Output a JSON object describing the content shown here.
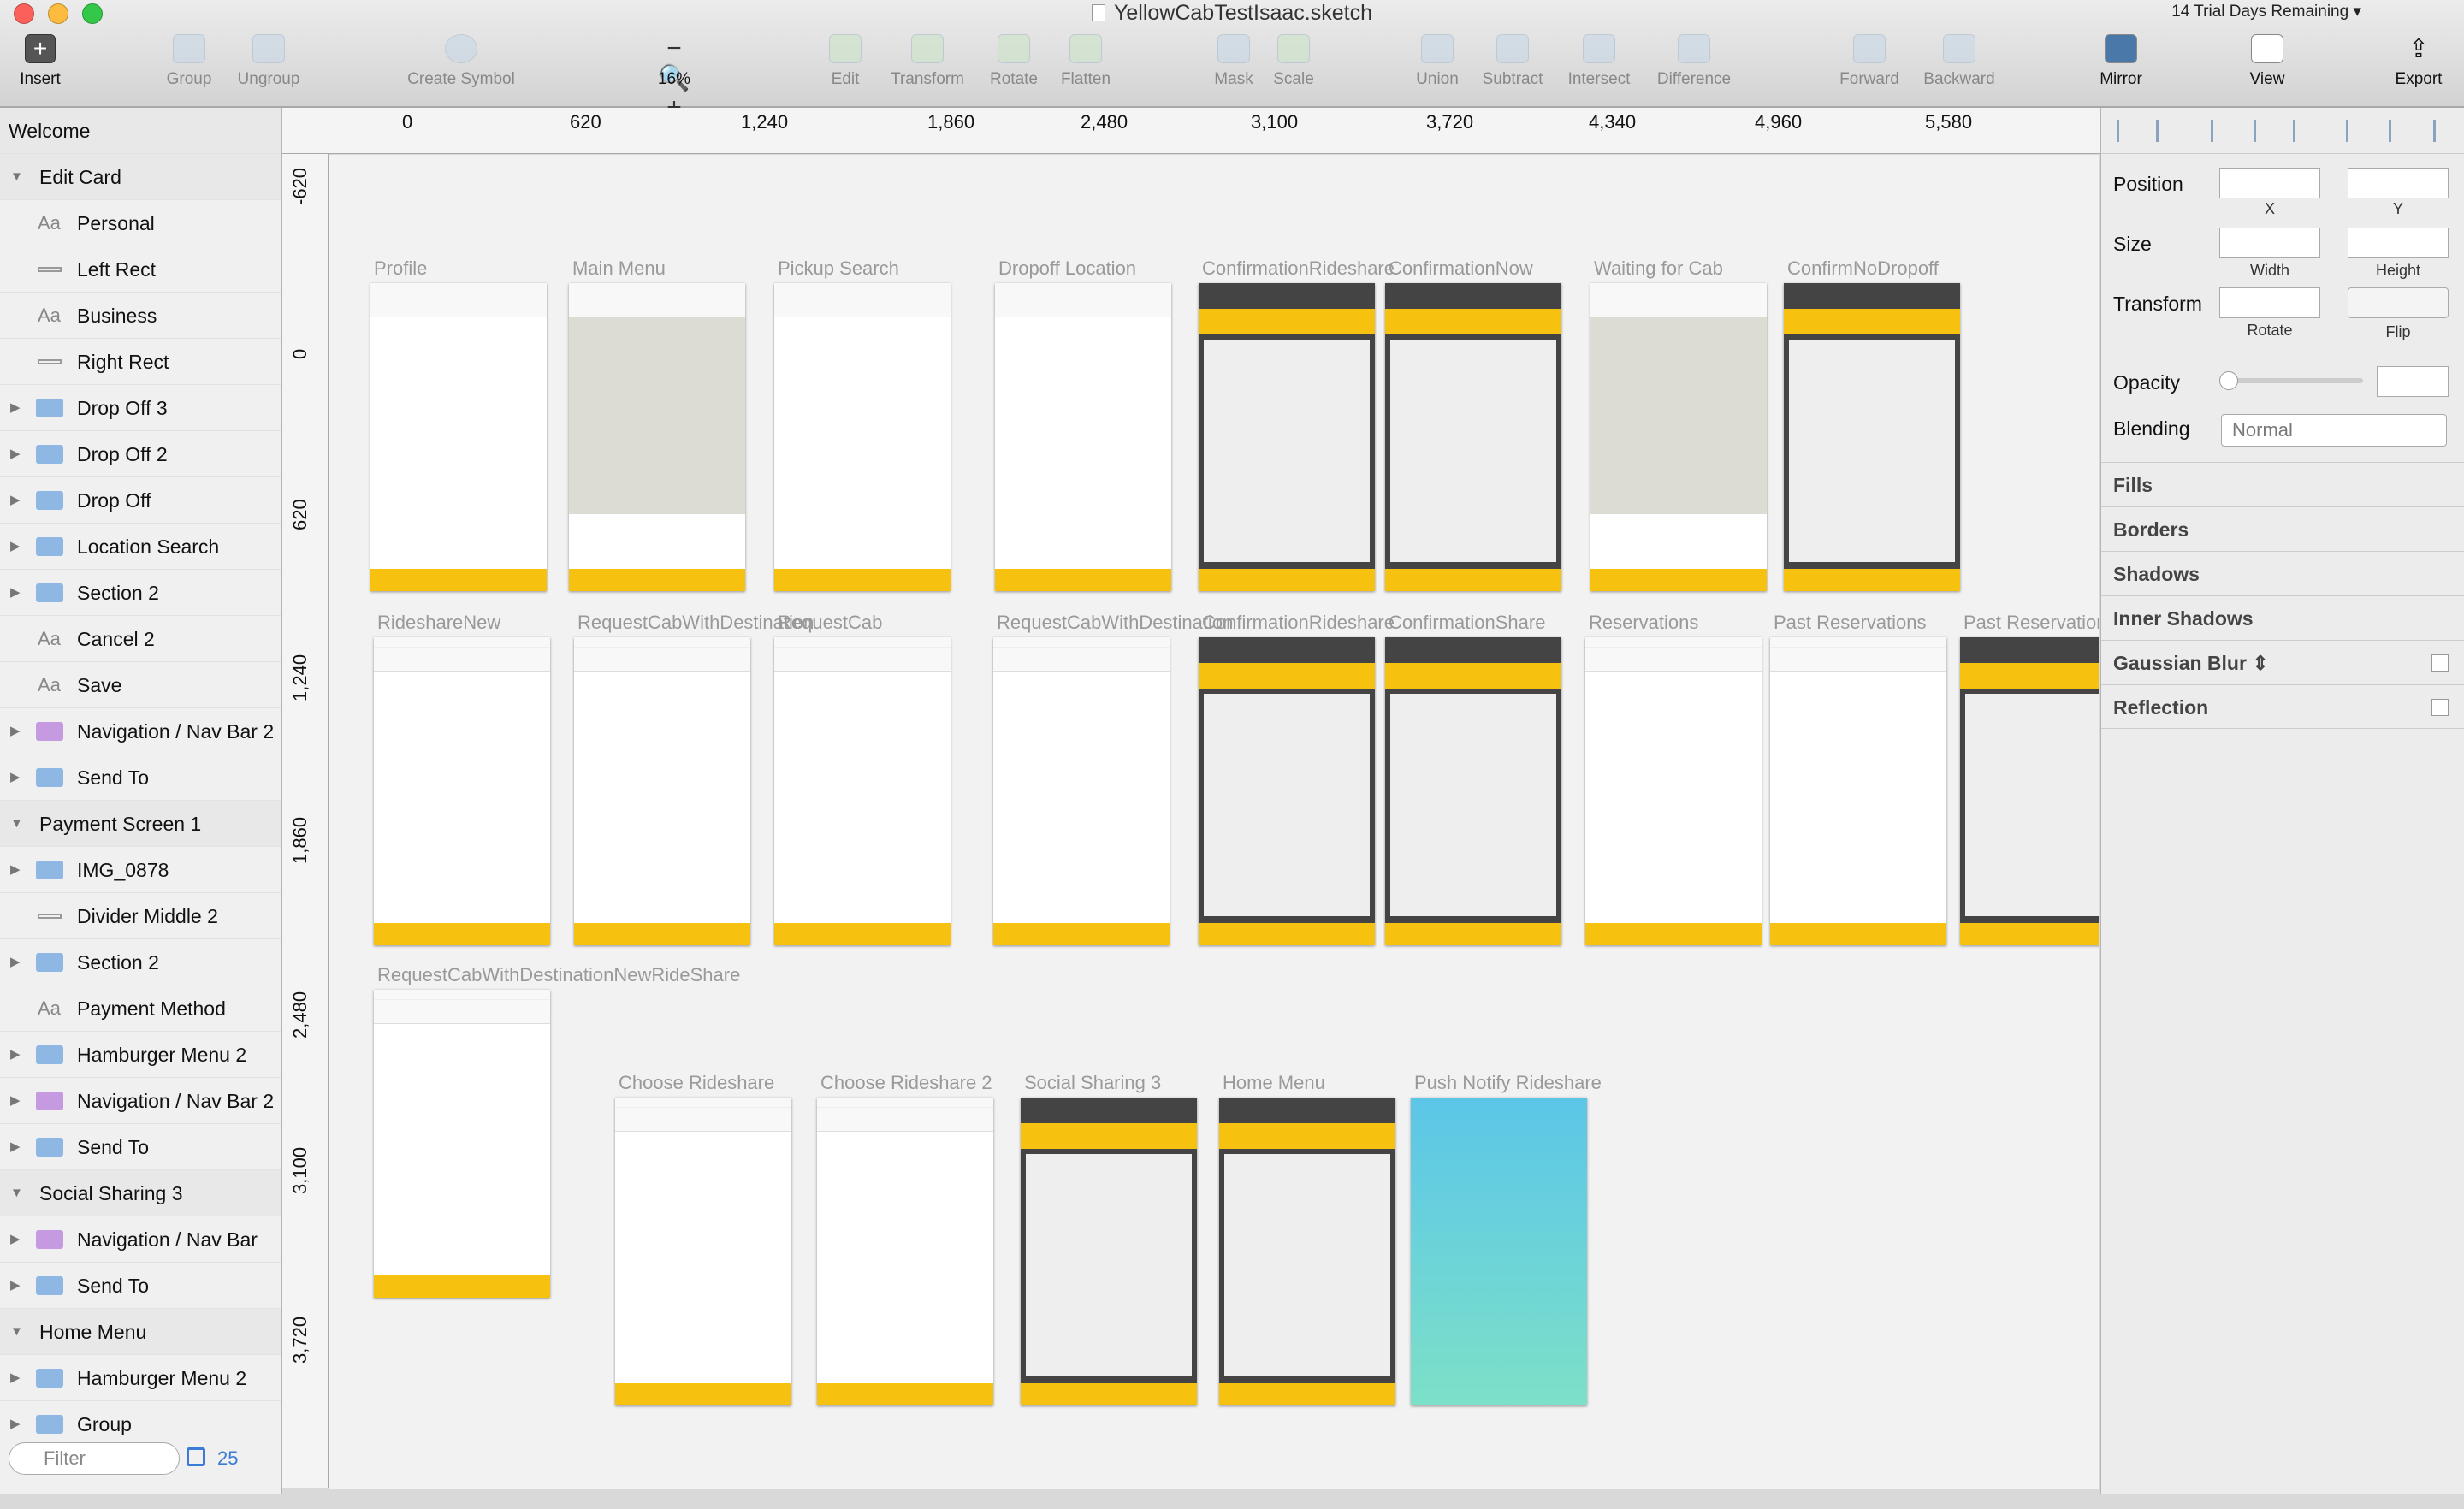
{
  "window": {
    "title": "YellowCabTestIsaac.sketch",
    "trial": "14 Trial Days Remaining ▾"
  },
  "toolbar": {
    "insert": "Insert",
    "group": "Group",
    "ungroup": "Ungroup",
    "create_symbol": "Create Symbol",
    "zoom": "16%",
    "edit": "Edit",
    "transform": "Transform",
    "rotate": "Rotate",
    "flatten": "Flatten",
    "mask": "Mask",
    "scale": "Scale",
    "union": "Union",
    "subtract": "Subtract",
    "intersect": "Intersect",
    "difference": "Difference",
    "forward": "Forward",
    "backward": "Backward",
    "mirror": "Mirror",
    "view": "View",
    "export": "Export"
  },
  "layers": [
    {
      "label": "Welcome",
      "kind": "page"
    },
    {
      "label": "Edit Card",
      "kind": "page"
    },
    {
      "label": "Personal",
      "kind": "text"
    },
    {
      "label": "Left Rect",
      "kind": "rect"
    },
    {
      "label": "Business",
      "kind": "text"
    },
    {
      "label": "Right Rect",
      "kind": "rect"
    },
    {
      "label": "Drop Off 3",
      "kind": "folder"
    },
    {
      "label": "Drop Off 2",
      "kind": "folder"
    },
    {
      "label": "Drop Off",
      "kind": "folder"
    },
    {
      "label": "Location Search",
      "kind": "folder"
    },
    {
      "label": "Section 2",
      "kind": "folder"
    },
    {
      "label": "Cancel 2",
      "kind": "text"
    },
    {
      "label": "Save",
      "kind": "text"
    },
    {
      "label": "Navigation / Nav Bar 2",
      "kind": "symbol"
    },
    {
      "label": "Send To",
      "kind": "folder"
    },
    {
      "label": "Payment Screen 1",
      "kind": "page"
    },
    {
      "label": "IMG_0878",
      "kind": "folder"
    },
    {
      "label": "Divider Middle 2",
      "kind": "rect"
    },
    {
      "label": "Section 2",
      "kind": "folder"
    },
    {
      "label": "Payment Method",
      "kind": "text"
    },
    {
      "label": "Hamburger Menu 2",
      "kind": "folder"
    },
    {
      "label": "Navigation / Nav Bar 2",
      "kind": "symbol"
    },
    {
      "label": "Send To",
      "kind": "folder"
    },
    {
      "label": "Social Sharing 3",
      "kind": "page"
    },
    {
      "label": "Navigation / Nav Bar",
      "kind": "symbol"
    },
    {
      "label": "Send To",
      "kind": "folder"
    },
    {
      "label": "Home Menu",
      "kind": "page"
    },
    {
      "label": "Hamburger Menu 2",
      "kind": "folder"
    },
    {
      "label": "Group",
      "kind": "folder"
    }
  ],
  "filter": {
    "placeholder": "Filter",
    "count": "25"
  },
  "ruler_h": [
    "0",
    "620",
    "1,240",
    "1,860",
    "2,480",
    "3,100",
    "3,720",
    "4,340",
    "4,960",
    "5,580"
  ],
  "ruler_v": [
    "-620",
    "0",
    "620",
    "1,240",
    "1,860",
    "2,480",
    "3,100",
    "3,720"
  ],
  "artboards": [
    {
      "title": "Profile"
    },
    {
      "title": "Main Menu"
    },
    {
      "title": "Pickup Search"
    },
    {
      "title": "Dropoff Location"
    },
    {
      "title": "ConfirmationRideshare"
    },
    {
      "title": "ConfirmationNow"
    },
    {
      "title": "Waiting for Cab"
    },
    {
      "title": "ConfirmNoDropoff"
    },
    {
      "title": "RideshareNew"
    },
    {
      "title": "RequestCabWithDestination"
    },
    {
      "title": "RequestCab"
    },
    {
      "title": "RequestCabWithDestination"
    },
    {
      "title": "ConfirmationRideshare"
    },
    {
      "title": "ConfirmationShare"
    },
    {
      "title": "Reservations"
    },
    {
      "title": "Past Reservations"
    },
    {
      "title": "Past Reservations"
    },
    {
      "title": "RequestCabWithDestinationNewRideShare"
    },
    {
      "title": "Choose Rideshare"
    },
    {
      "title": "Choose Rideshare 2"
    },
    {
      "title": "Social Sharing 3"
    },
    {
      "title": "Home Menu"
    },
    {
      "title": "Push Notify Rideshare"
    }
  ],
  "inspector": {
    "position": "Position",
    "x": "X",
    "y": "Y",
    "size": "Size",
    "width": "Width",
    "height": "Height",
    "transform": "Transform",
    "rotate": "Rotate",
    "flip": "Flip",
    "opacity": "Opacity",
    "blending": "Blending",
    "blending_value": "Normal",
    "fills": "Fills",
    "borders": "Borders",
    "shadows": "Shadows",
    "inner_shadows": "Inner Shadows",
    "gaussian_blur": "Gaussian Blur ⇕",
    "reflection": "Reflection"
  }
}
